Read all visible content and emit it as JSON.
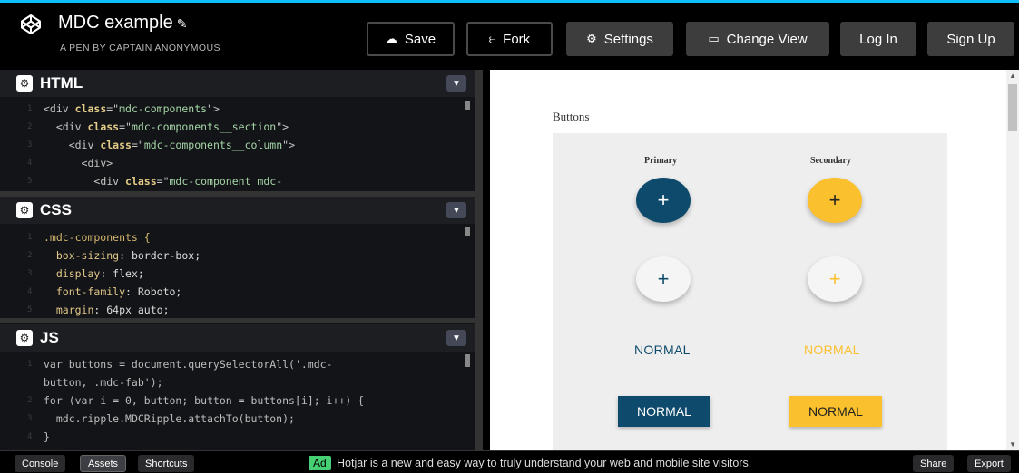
{
  "header": {
    "title": "MDC example",
    "byline": "A PEN BY CAPTAIN ANONYMOUS",
    "buttons": {
      "save": "Save",
      "fork": "Fork",
      "settings": "Settings",
      "change_view": "Change View",
      "login": "Log In",
      "signup": "Sign Up"
    }
  },
  "panes": {
    "html": {
      "label": "HTML",
      "lines": [
        {
          "n": "1",
          "indent": "",
          "parts": [
            [
              "tag",
              "<div "
            ],
            [
              "attr",
              "class"
            ],
            [
              "tag",
              "=\""
            ],
            [
              "str",
              "mdc-components"
            ],
            [
              "tag",
              "\">"
            ]
          ]
        },
        {
          "n": "2",
          "indent": "  ",
          "parts": [
            [
              "tag",
              "<div "
            ],
            [
              "attr",
              "class"
            ],
            [
              "tag",
              "=\""
            ],
            [
              "str",
              "mdc-components__section"
            ],
            [
              "tag",
              "\">"
            ]
          ]
        },
        {
          "n": "3",
          "indent": "    ",
          "parts": [
            [
              "tag",
              "<div "
            ],
            [
              "attr",
              "class"
            ],
            [
              "tag",
              "=\""
            ],
            [
              "str",
              "mdc-components__column"
            ],
            [
              "tag",
              "\">"
            ]
          ]
        },
        {
          "n": "4",
          "indent": "      ",
          "parts": [
            [
              "tag",
              "<div>"
            ]
          ]
        },
        {
          "n": "5",
          "indent": "        ",
          "parts": [
            [
              "tag",
              "<div "
            ],
            [
              "attr",
              "class"
            ],
            [
              "tag",
              "=\""
            ],
            [
              "str",
              "mdc-component mdc-"
            ]
          ]
        }
      ]
    },
    "css": {
      "label": "CSS",
      "lines": [
        {
          "n": "1",
          "indent": "",
          "parts": [
            [
              "sel",
              ".mdc-components {"
            ]
          ]
        },
        {
          "n": "2",
          "indent": "  ",
          "parts": [
            [
              "prop",
              "box-sizing"
            ],
            [
              "val",
              ": border-box;"
            ]
          ]
        },
        {
          "n": "3",
          "indent": "  ",
          "parts": [
            [
              "prop",
              "display"
            ],
            [
              "val",
              ": flex;"
            ]
          ]
        },
        {
          "n": "4",
          "indent": "  ",
          "parts": [
            [
              "prop",
              "font-family"
            ],
            [
              "val",
              ": Roboto;"
            ]
          ]
        },
        {
          "n": "5",
          "indent": "  ",
          "parts": [
            [
              "prop",
              "margin"
            ],
            [
              "val",
              ": 64px auto;"
            ]
          ]
        }
      ]
    },
    "js": {
      "label": "JS",
      "lines": [
        {
          "n": "1",
          "indent": "",
          "parts": [
            [
              "kw",
              "var buttons = document.querySelectorAll('.mdc-"
            ]
          ]
        },
        {
          "n": "",
          "indent": "",
          "parts": [
            [
              "kw",
              "button, .mdc-fab');"
            ]
          ]
        },
        {
          "n": "2",
          "indent": "",
          "parts": [
            [
              "kw",
              "for (var i = 0, button; button = buttons[i]; i++) {"
            ]
          ]
        },
        {
          "n": "3",
          "indent": "  ",
          "parts": [
            [
              "kw",
              "mdc.ripple.MDCRipple.attachTo(button);"
            ]
          ]
        },
        {
          "n": "4",
          "indent": "",
          "parts": [
            [
              "kw",
              "}"
            ]
          ]
        }
      ]
    }
  },
  "preview": {
    "heading": "Buttons",
    "primary_label": "Primary",
    "secondary_label": "Secondary",
    "plus": "+",
    "normal": "NORMAL",
    "colors": {
      "primary": "#0e4a6b",
      "secondary": "#fbc02d"
    }
  },
  "footer": {
    "console": "Console",
    "assets": "Assets",
    "shortcuts": "Shortcuts",
    "ad_badge": "Ad",
    "ad_text": "Hotjar is a new and easy way to truly understand your web and mobile site visitors.",
    "share": "Share",
    "export": "Export"
  }
}
